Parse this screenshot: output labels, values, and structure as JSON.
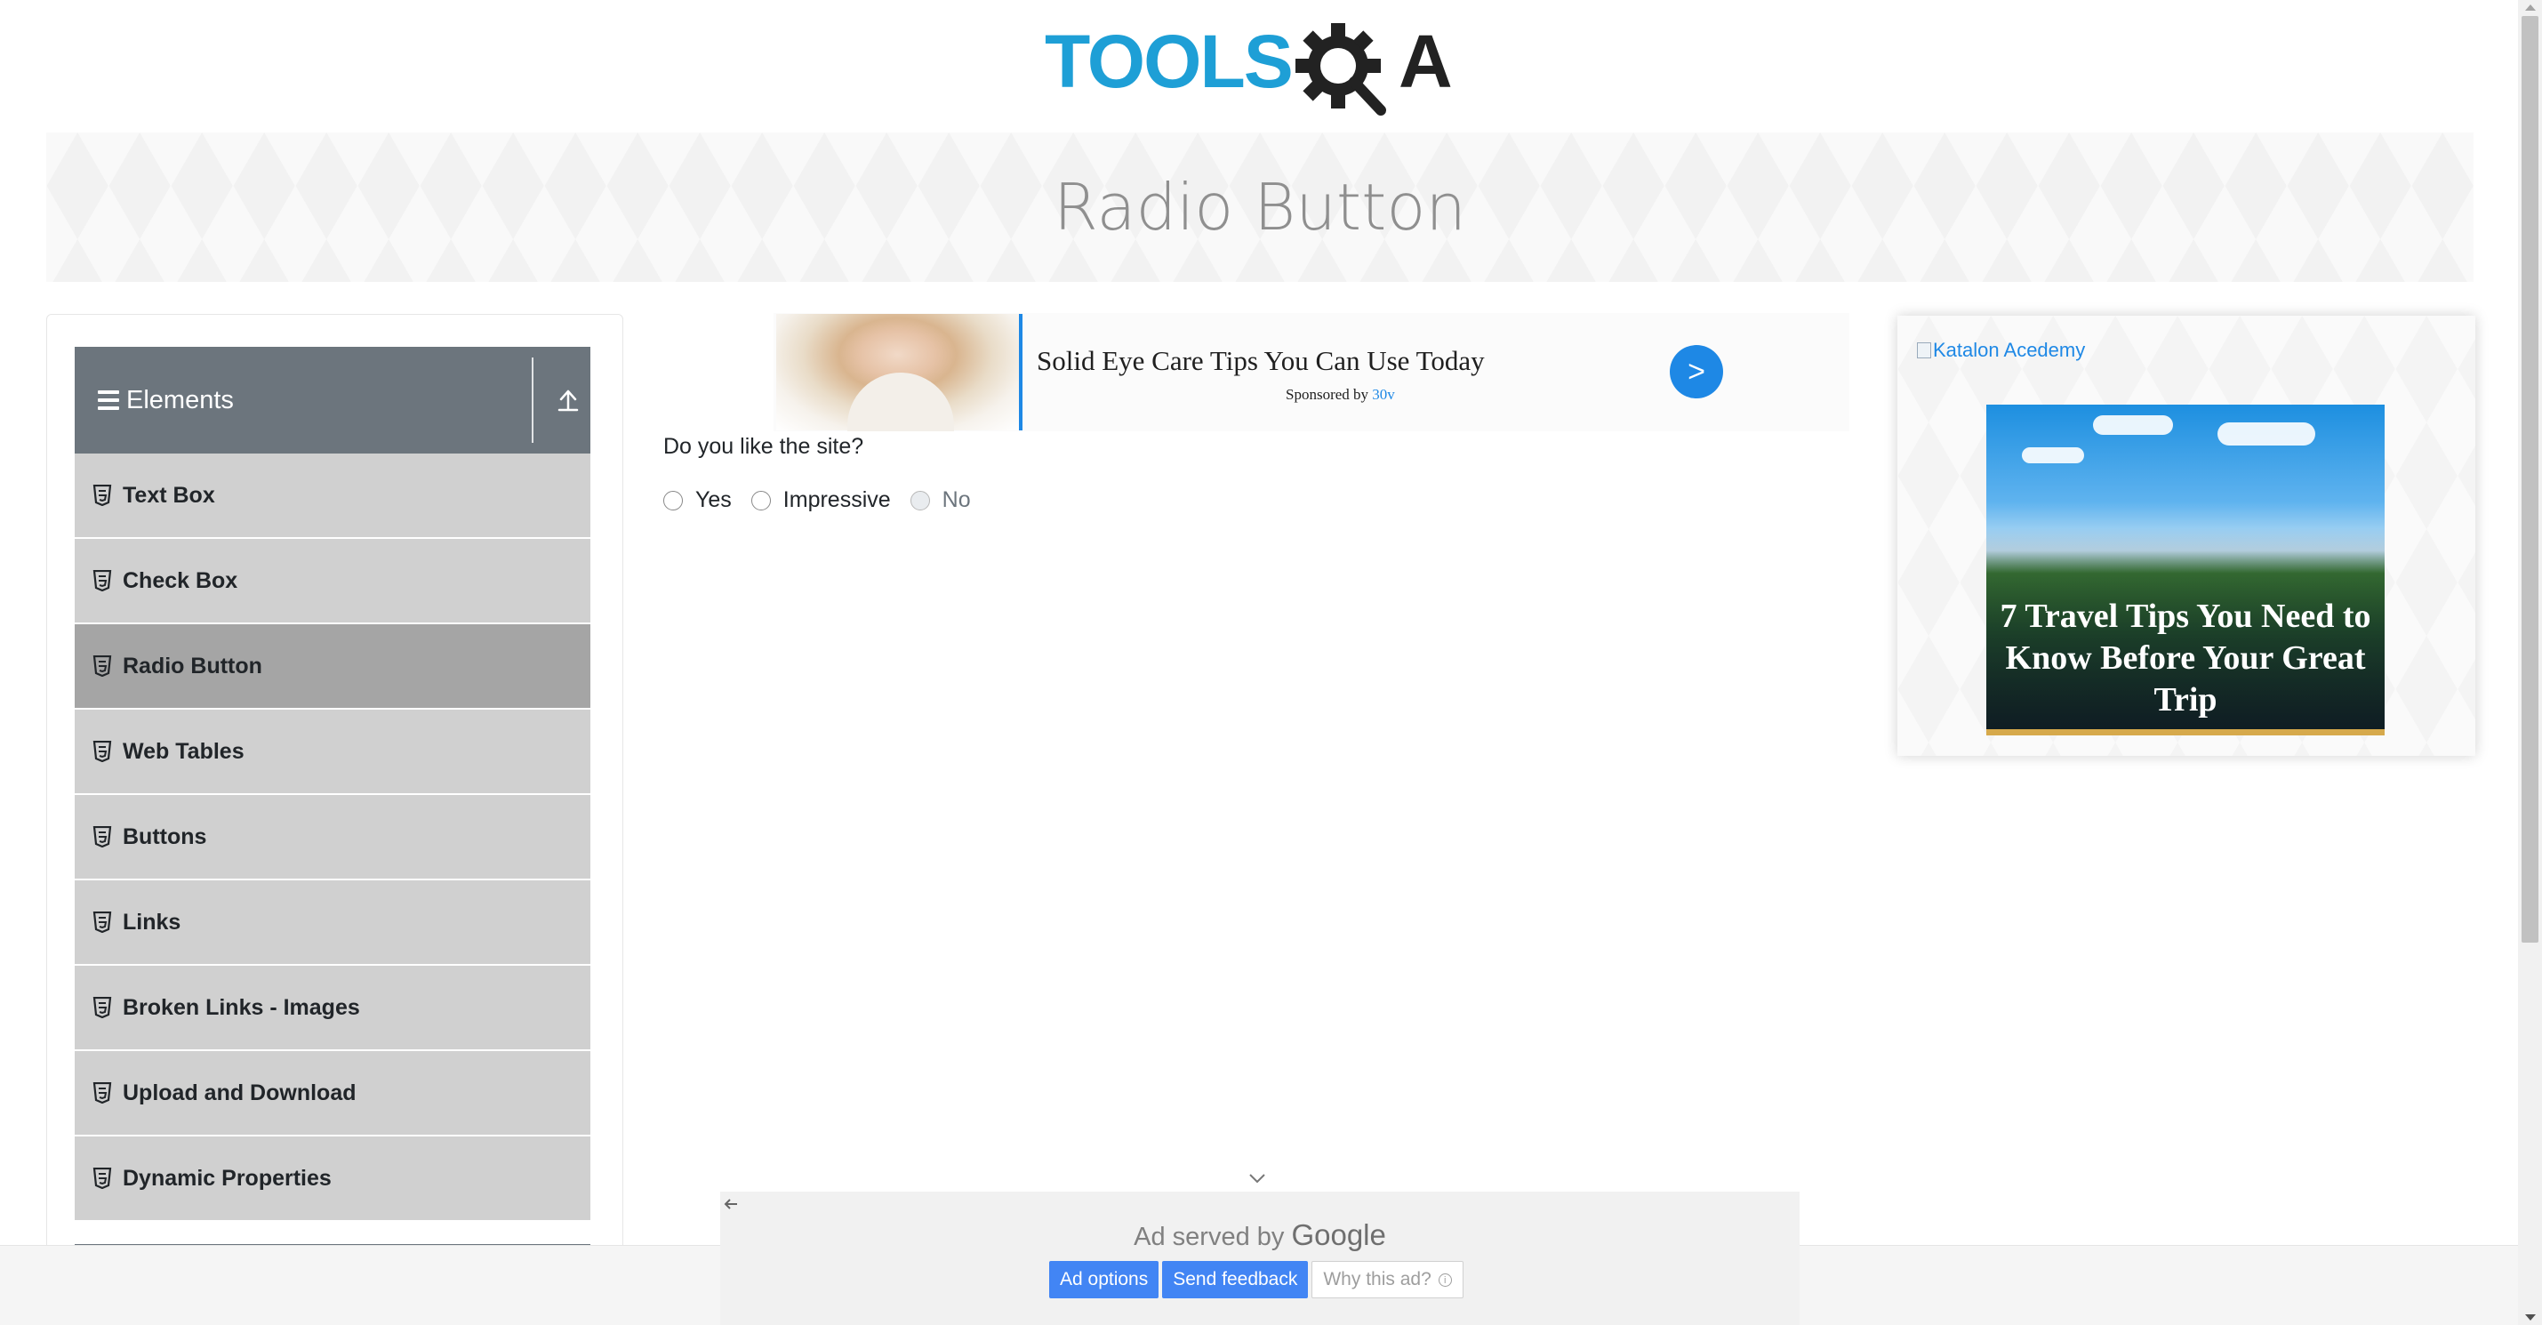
{
  "header": {
    "logo_text": "TOOLSQA"
  },
  "banner": {
    "title": "Radio Button"
  },
  "sidebar": {
    "group_label": "Elements",
    "items": [
      {
        "label": "Text Box"
      },
      {
        "label": "Check Box"
      },
      {
        "label": "Radio Button",
        "active": true
      },
      {
        "label": "Web Tables"
      },
      {
        "label": "Buttons"
      },
      {
        "label": "Links"
      },
      {
        "label": "Broken Links - Images"
      },
      {
        "label": "Upload and Download"
      },
      {
        "label": "Dynamic Properties"
      }
    ]
  },
  "ad_top": {
    "headline": "Solid Eye Care Tips You Can Use Today",
    "sponsored_prefix": "Sponsored by",
    "sponsor": "30v",
    "go_label": ">"
  },
  "form": {
    "question": "Do you like the site?",
    "options": [
      {
        "label": "Yes",
        "disabled": false
      },
      {
        "label": "Impressive",
        "disabled": false
      },
      {
        "label": "No",
        "disabled": true
      }
    ]
  },
  "side_ad": {
    "alt_text": "Katalon Acedemy",
    "caption": "7 Travel Tips You Need to Know Before Your Great Trip"
  },
  "google_ad": {
    "served_by": "Ad served by",
    "brand": "Google",
    "ad_options": "Ad options",
    "send_feedback": "Send feedback",
    "why_this_ad": "Why this ad?"
  },
  "colors": {
    "brand_blue": "#1e88e5",
    "logo_blue": "#1e9fd6",
    "sidebar_header": "#6c757d",
    "menu_item_bg": "#d0d0d0",
    "menu_item_active_bg": "#a5a5a5",
    "google_blue": "#4285f4"
  }
}
